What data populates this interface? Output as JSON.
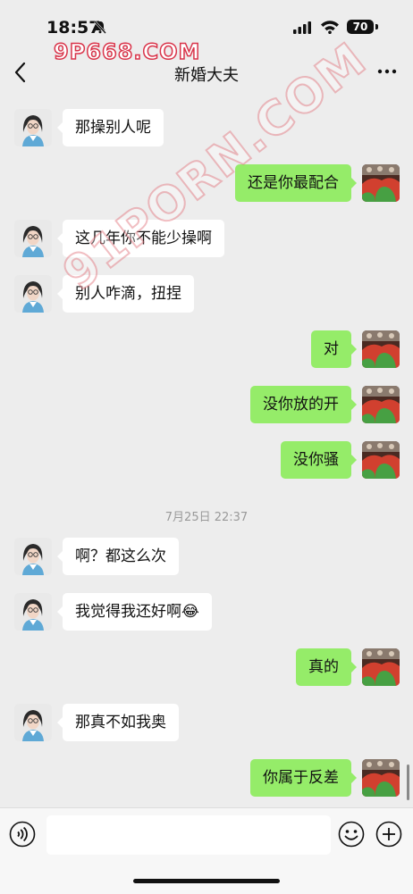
{
  "status_bar": {
    "time": "18:57",
    "battery": "70"
  },
  "watermark": {
    "top": "9P668.COM",
    "diagonal": "91PORN.COM"
  },
  "header": {
    "title": "新婚大夫"
  },
  "messages": [
    {
      "side": "in",
      "text": "那操别人呢"
    },
    {
      "side": "out",
      "text": "还是你最配合"
    },
    {
      "side": "in",
      "text": "这几年你不能少操啊"
    },
    {
      "side": "in",
      "text": "别人咋滴，扭捏"
    },
    {
      "side": "out",
      "text": "对"
    },
    {
      "side": "out",
      "text": "没你放的开"
    },
    {
      "side": "out",
      "text": "没你骚"
    },
    {
      "side": "in",
      "text": "啊？都这么次"
    },
    {
      "side": "in",
      "text": "我觉得我还好啊😂"
    },
    {
      "side": "out",
      "text": "真的"
    },
    {
      "side": "in",
      "text": "那真不如我奥"
    },
    {
      "side": "out",
      "text": "你属于反差"
    }
  ],
  "timestamp": "7月25日 22:37",
  "colors": {
    "outgoing_bubble": "#95ec69",
    "incoming_bubble": "#ffffff",
    "background": "#ededed"
  }
}
